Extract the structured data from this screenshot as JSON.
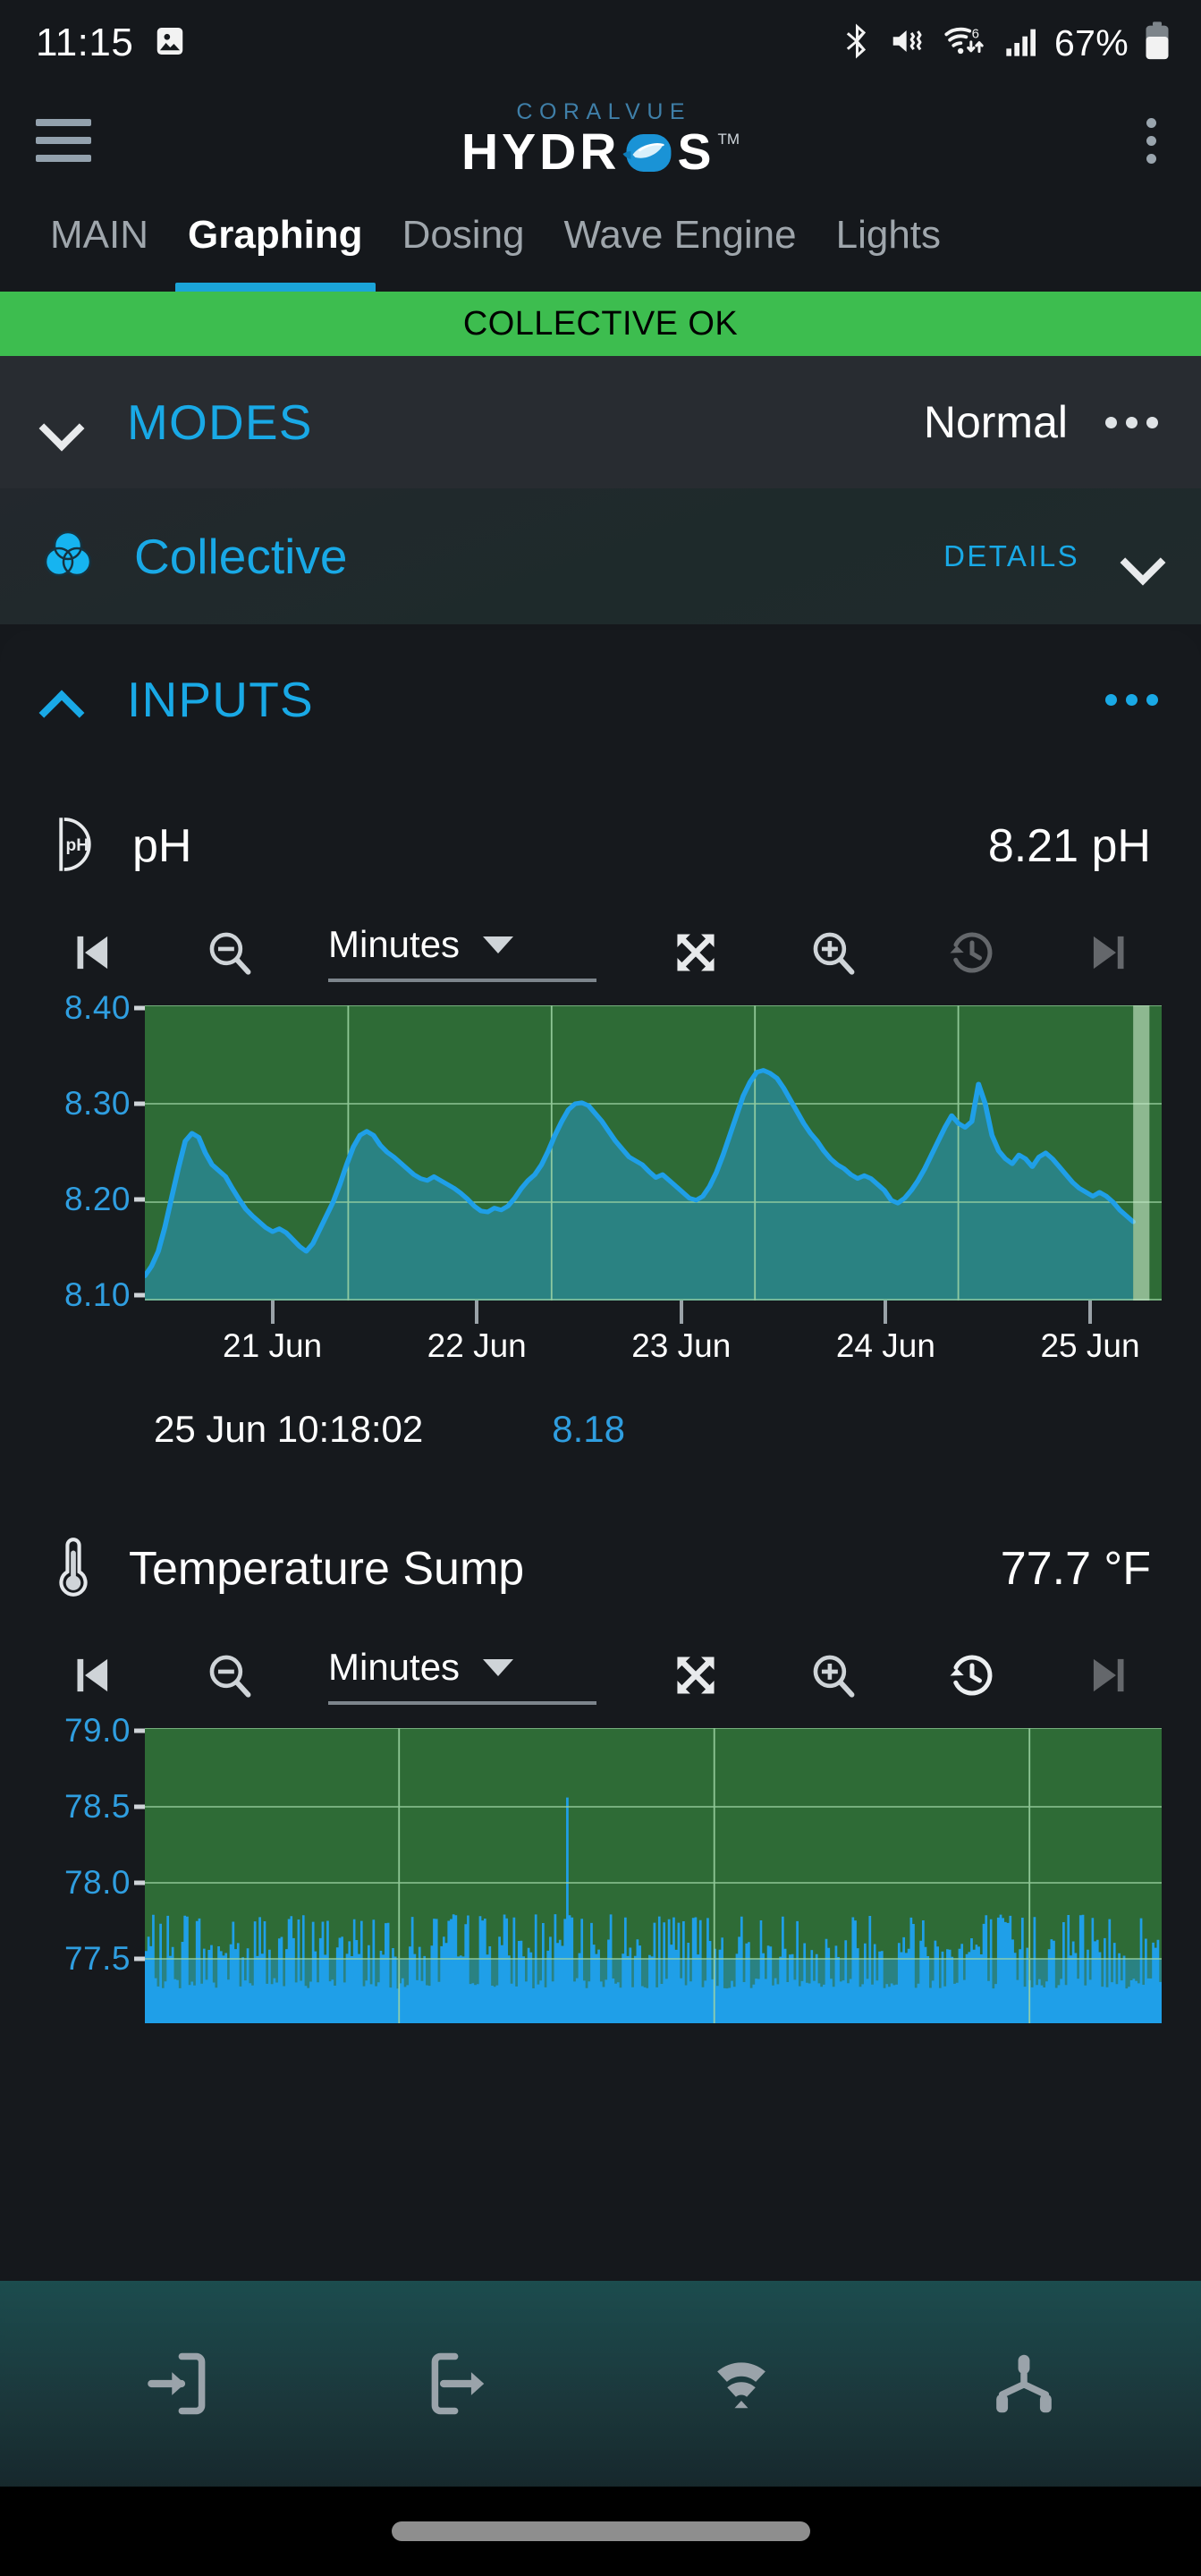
{
  "status_bar": {
    "time": "11:15",
    "battery_percent": "67%",
    "icons": [
      "image-icon",
      "bluetooth-icon",
      "mute-vibrate-icon",
      "wifi-6-icon",
      "cellular-signal-icon",
      "battery-icon"
    ]
  },
  "header": {
    "menu_icon": "hamburger-menu-icon",
    "brand_top": "CORALVUE",
    "brand_main": "HYDR",
    "brand_main_tail": "S",
    "brand_tm": "TM",
    "overflow_icon": "kebab-menu-icon"
  },
  "tabs": [
    {
      "label": "MAIN",
      "active": false
    },
    {
      "label": "Graphing",
      "active": true
    },
    {
      "label": "Dosing",
      "active": false
    },
    {
      "label": "Wave Engine",
      "active": false
    },
    {
      "label": "Lights",
      "active": false
    }
  ],
  "banner": {
    "text": "COLLECTIVE OK",
    "color": "#3dbd4f"
  },
  "modes": {
    "title": "MODES",
    "value": "Normal",
    "chevron": "chevron-down-icon",
    "overflow": "kebab-menu-icon"
  },
  "collective": {
    "title": "Collective",
    "icon": "collective-venn-icon",
    "details_label": "DETAILS",
    "chevron": "chevron-down-icon"
  },
  "inputs": {
    "title": "INPUTS",
    "chevron": "chevron-up-icon",
    "overflow": "kebab-menu-icon"
  },
  "toolbar": {
    "skip_prev": "skip-previous-icon",
    "zoom_out": "zoom-out-icon",
    "interval": "Minutes",
    "fullscreen": "expand-arrows-icon",
    "zoom_in": "zoom-in-icon",
    "history": "history-clock-icon",
    "skip_next": "skip-next-icon"
  },
  "sensors": [
    {
      "name": "pH",
      "icon": "ph-probe-icon",
      "value": "8.21 pH",
      "readout_time": "25 Jun 10:18:02",
      "readout_value": "8.18"
    },
    {
      "name": "Temperature Sump",
      "icon": "thermometer-icon",
      "value": "77.7 °F"
    }
  ],
  "bottom_nav": [
    {
      "icon": "input-arrow-icon"
    },
    {
      "icon": "output-arrow-icon"
    },
    {
      "icon": "wifi-signal-icon"
    },
    {
      "icon": "network-node-icon"
    }
  ],
  "colors": {
    "accent_cyan": "#19a9e6",
    "ok_green": "#3dbd4f",
    "plot_band_green": "#2e6b36",
    "plot_fill_teal": "#2a8282",
    "line_blue": "#1f9fe8",
    "axis_blue": "#2f9ee0"
  },
  "chart_data": [
    {
      "type": "area",
      "title": "pH",
      "xlabel": "",
      "ylabel": "pH",
      "ylim": [
        8.1,
        8.4
      ],
      "yticks": [
        "8.40",
        "8.30",
        "8.20",
        "8.10"
      ],
      "ytick_values": [
        8.4,
        8.3,
        8.2,
        8.1
      ],
      "xticks": [
        "21 Jun",
        "22 Jun",
        "23 Jun",
        "24 Jun",
        "25 Jun"
      ],
      "grid": true,
      "legend": "none",
      "band_green_from": 8.2,
      "band_green_to": 8.4,
      "cursor_value": "8.18",
      "cursor_time": "25 Jun 10:18:02",
      "values": [
        8.125,
        8.135,
        8.15,
        8.175,
        8.205,
        8.235,
        8.262,
        8.27,
        8.266,
        8.25,
        8.238,
        8.232,
        8.226,
        8.214,
        8.203,
        8.193,
        8.186,
        8.18,
        8.174,
        8.17,
        8.173,
        8.169,
        8.162,
        8.155,
        8.15,
        8.158,
        8.172,
        8.186,
        8.2,
        8.218,
        8.238,
        8.256,
        8.268,
        8.272,
        8.268,
        8.258,
        8.251,
        8.246,
        8.24,
        8.234,
        8.228,
        8.224,
        8.222,
        8.226,
        8.222,
        8.218,
        8.214,
        8.209,
        8.203,
        8.196,
        8.191,
        8.19,
        8.194,
        8.192,
        8.196,
        8.204,
        8.214,
        8.222,
        8.228,
        8.238,
        8.252,
        8.268,
        8.282,
        8.294,
        8.3,
        8.301,
        8.298,
        8.29,
        8.282,
        8.272,
        8.262,
        8.254,
        8.246,
        8.242,
        8.238,
        8.231,
        8.225,
        8.228,
        8.222,
        8.216,
        8.21,
        8.204,
        8.202,
        8.206,
        8.216,
        8.23,
        8.248,
        8.268,
        8.288,
        8.308,
        8.322,
        8.332,
        8.334,
        8.331,
        8.326,
        8.316,
        8.304,
        8.292,
        8.28,
        8.27,
        8.262,
        8.252,
        8.244,
        8.238,
        8.234,
        8.228,
        8.224,
        8.227,
        8.224,
        8.218,
        8.212,
        8.202,
        8.199,
        8.204,
        8.212,
        8.222,
        8.234,
        8.248,
        8.262,
        8.276,
        8.288,
        8.28,
        8.276,
        8.282,
        8.32,
        8.3,
        8.268,
        8.252,
        8.244,
        8.239,
        8.248,
        8.244,
        8.236,
        8.246,
        8.25,
        8.244,
        8.236,
        8.228,
        8.22,
        8.214,
        8.21,
        8.206,
        8.21,
        8.206,
        8.2,
        8.192,
        8.186,
        8.18
      ]
    },
    {
      "type": "area",
      "title": "Temperature Sump",
      "xlabel": "",
      "ylabel": "°F",
      "ylim": [
        77.3,
        79.0
      ],
      "yticks": [
        "79.0",
        "78.5",
        "78.0",
        "77.5"
      ],
      "ytick_values": [
        79.0,
        78.5,
        78.0,
        77.5
      ],
      "grid": true,
      "legend": "none",
      "band_green_from": 77.5,
      "band_green_to": 79.0,
      "spike_peak": 78.6,
      "oscillation_low": 77.5,
      "oscillation_high": 77.9
    }
  ]
}
